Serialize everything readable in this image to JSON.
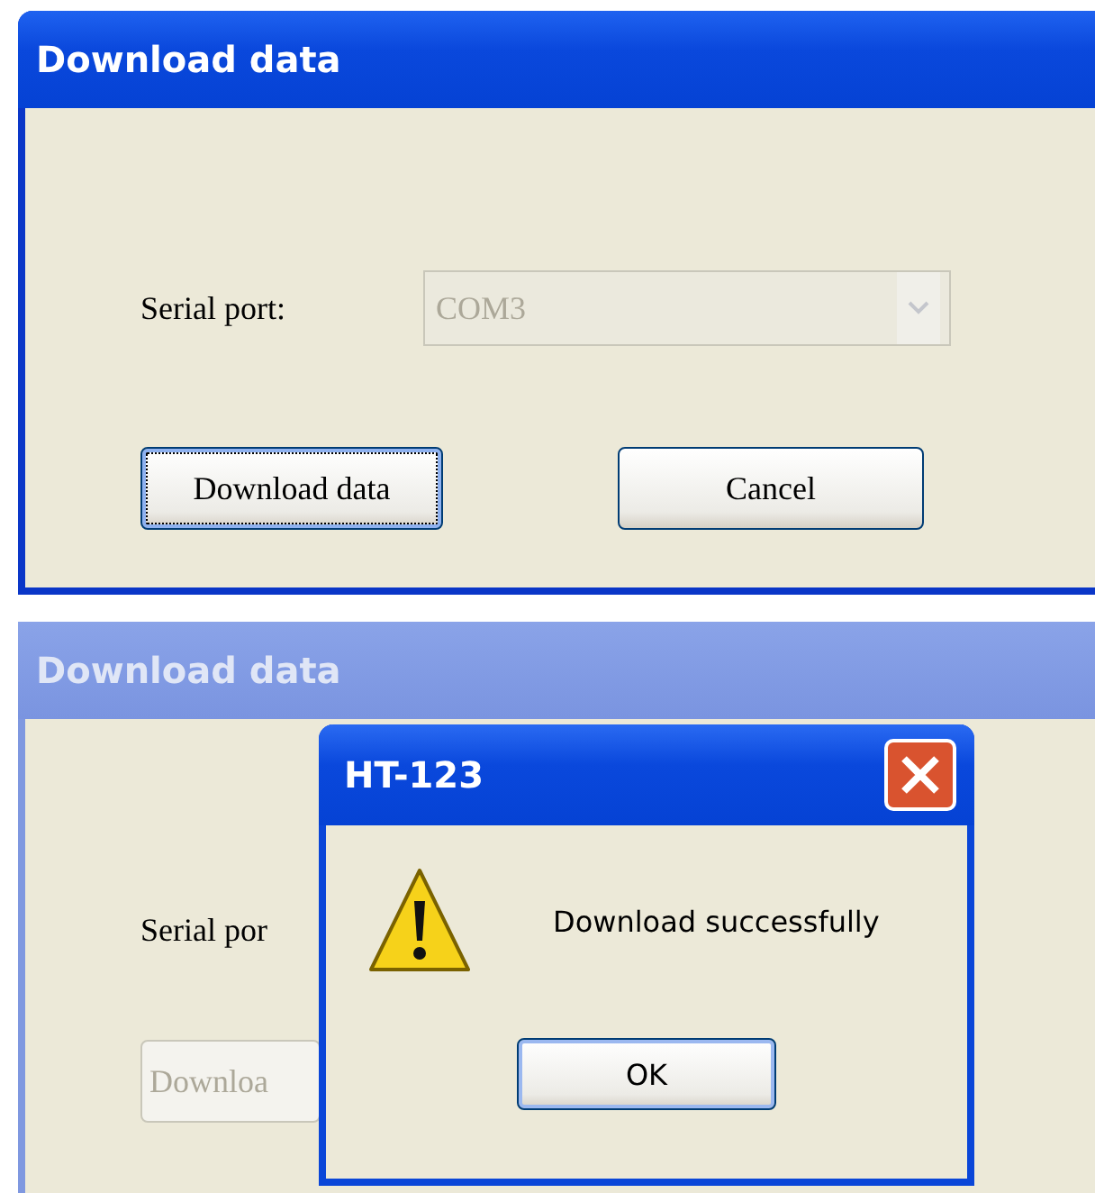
{
  "windows": [
    {
      "title": "Download data",
      "active": true,
      "serial_label": "Serial port:",
      "port": {
        "value": "COM3",
        "disabled": true
      },
      "buttons": [
        {
          "label": "Download data",
          "focused": true,
          "disabled": false
        },
        {
          "label": "Cancel",
          "focused": false,
          "disabled": false
        }
      ]
    },
    {
      "title": "Download data",
      "active": false,
      "serial_label": "Serial por",
      "buttons": [
        {
          "label": "Downloa",
          "focused": false,
          "disabled": true
        }
      ],
      "message_box": {
        "title": "HT-123",
        "message": "Download successfully",
        "button": "OK"
      }
    }
  ]
}
